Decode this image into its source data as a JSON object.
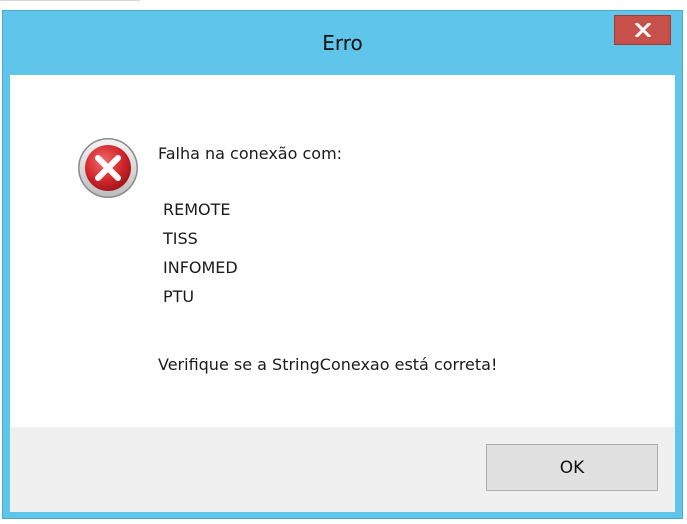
{
  "dialog": {
    "title": "Erro",
    "close_label": "x",
    "icon": "error-icon",
    "message_heading": "Falha na conexão com:",
    "servers": [
      "REMOTE",
      "TISS",
      "INFOMED",
      "PTU"
    ],
    "message_footer": "Verifique se a StringConexao está correta!",
    "ok_label": "OK"
  },
  "colors": {
    "titlebar": "#5fc5ea",
    "close_button": "#c7504a",
    "error_red": "#c8252b",
    "button_bar": "#f0f0f0"
  }
}
